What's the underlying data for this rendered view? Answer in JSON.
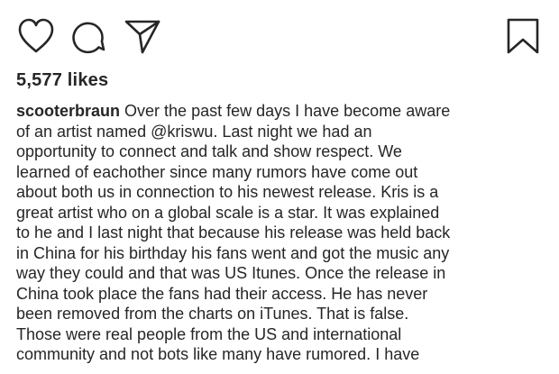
{
  "actions": {
    "like_icon": "heart-icon",
    "comment_icon": "comment-icon",
    "share_icon": "paper-plane-icon",
    "save_icon": "bookmark-icon"
  },
  "likes_text": "5,577 likes",
  "caption": {
    "username": "scooterbraun",
    "text": " Over the past few days I have become aware\nof an artist named @kriswu. Last night we had an\nopportunity to connect and talk and show respect. We\nlearned of eachother since many rumors have come out\nabout both us in connection to his newest release. Kris is a\ngreat artist who on a global scale is a star. It was explained\nto he and I last night that because his release was held back\nin China for his birthday his fans went and got the music any\nway they could and that was US Itunes. Once the release in\nChina took place the fans had their access. He has never\nbeen removed from the charts on iTunes. That is false.\nThose were real people from the US and international\ncommunity and not bots like many have rumored. I have"
  },
  "colors": {
    "text": "#262626",
    "background": "#ffffff"
  }
}
